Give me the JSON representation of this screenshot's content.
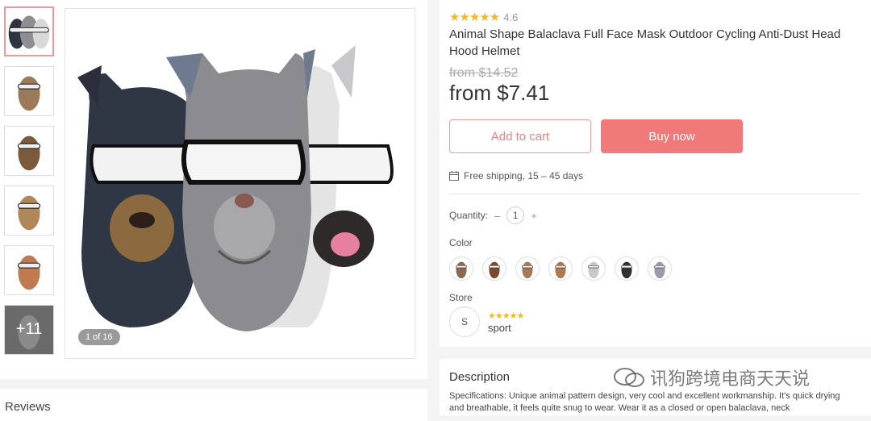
{
  "gallery": {
    "pager": "1 of 16",
    "more_count": "+11"
  },
  "reviews": {
    "title": "Reviews"
  },
  "product": {
    "rating": "4.6",
    "rating_stars": "★★★★★",
    "title": "Animal Shape Balaclava Full Face Mask Outdoor Cycling Anti-Dust Head Hood Helmet",
    "old_price": "from $14.52",
    "price": "from $7.41",
    "add_to_cart": "Add to cart",
    "buy_now": "Buy now",
    "shipping": "Free shipping, 15 – 45 days",
    "quantity_label": "Quantity:",
    "qty_minus": "–",
    "qty_value": "1",
    "qty_plus": "+",
    "color_label": "Color",
    "store_label": "Store",
    "store_initial": "S",
    "store_stars": "★★★★★",
    "store_name": "sport"
  },
  "description": {
    "title": "Description",
    "text": "Specifications:  Unique animal pattern design, very cool and excellent workmanship.  It's quick drying and breathable, it feels quite snug to wear.  Wear it as a closed or open balaclava, neck"
  },
  "watermark": {
    "text": "讯狗跨境电商天天说"
  },
  "colors": {
    "accent": "#f07a7a",
    "star": "#f3b92a",
    "variants": [
      "#8a6a50",
      "#7a4a30",
      "#a07a5a",
      "#b07850",
      "#c8c8d0",
      "#303038",
      "#9a9aa8"
    ]
  }
}
